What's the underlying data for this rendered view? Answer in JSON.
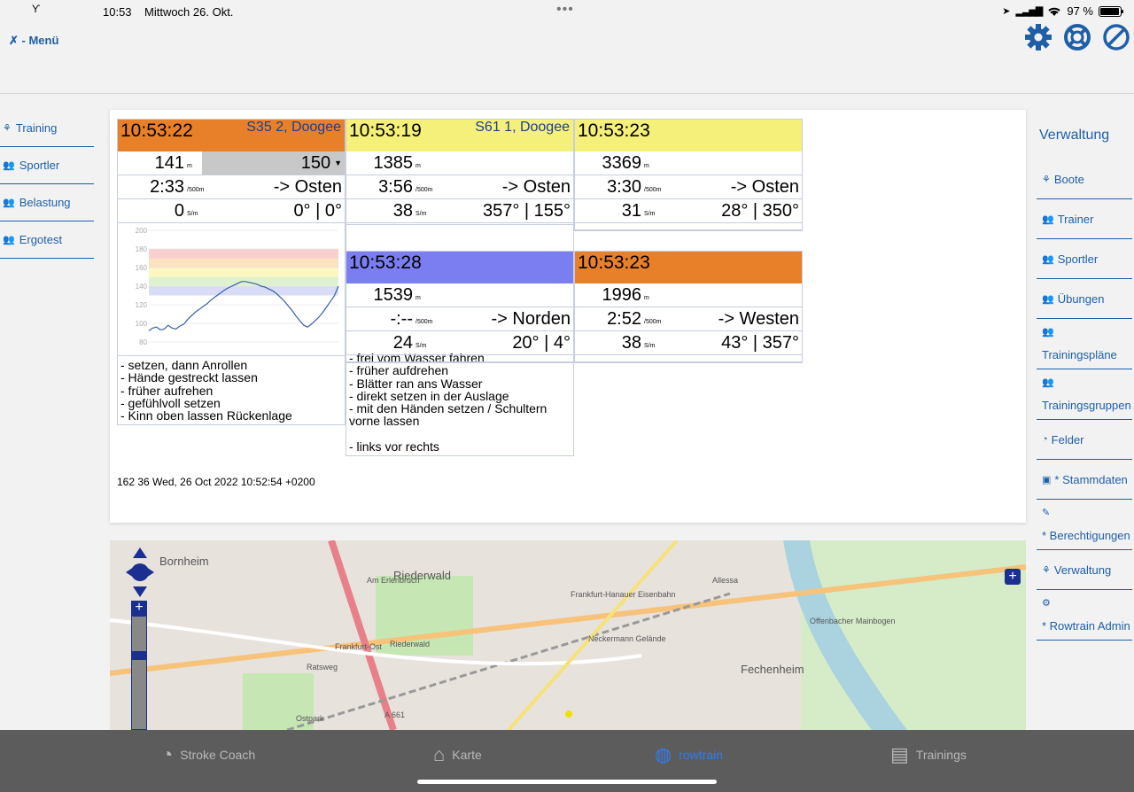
{
  "status": {
    "time": "10:53",
    "date": "Mittwoch 26. Okt.",
    "battery": "97 %",
    "battery_level": 0.97
  },
  "menu": {
    "label": "- Menü"
  },
  "left_nav": [
    {
      "label": "Training",
      "icon": "boats-icon"
    },
    {
      "label": "Sportler",
      "icon": "users-icon"
    },
    {
      "label": "Belastung",
      "icon": "users-icon"
    },
    {
      "label": "Ergotest",
      "icon": "users-icon"
    }
  ],
  "right_nav": {
    "title": "Verwaltung",
    "items": [
      {
        "label": "Boote",
        "icon": "boats-icon"
      },
      {
        "label": "Trainer",
        "icon": "users-icon"
      },
      {
        "label": "Sportler",
        "icon": "users-icon"
      },
      {
        "label": "Übungen",
        "icon": "users-icon"
      },
      {
        "label": "Trainingspläne",
        "icon": "users-icon"
      },
      {
        "label": "Trainingsgruppen",
        "icon": "users-icon"
      },
      {
        "label": "Felder",
        "icon": "dashboard-icon"
      },
      {
        "label": "* Stammdaten",
        "icon": "briefcase-icon"
      },
      {
        "label": "* Berechtigungen",
        "icon": "wrench-icon"
      },
      {
        "label": "Verwaltung",
        "icon": "boats-icon"
      },
      {
        "label": "* Rowtrain Admin",
        "icon": "gears-icon"
      }
    ]
  },
  "cards": [
    {
      "time": "10:53:22",
      "boat": "S35 2, Doogee",
      "color": "#e8802a",
      "distance": "141",
      "distance_unit": "m",
      "target": "150",
      "split": "2:33",
      "split_unit": "/500m",
      "direction": "-> Osten",
      "rate": "0",
      "rate_unit": "S/m",
      "angles": "0° | 0°",
      "notes": "- setzen, dann Anrollen\n- Hände gestreckt lassen\n- früher aufrehen\n- gefühlvoll setzen\n- Kinn oben lassen Rückenlage"
    },
    {
      "time": "10:53:19",
      "boat": "S61 1, Doogee",
      "color": "#f4f07a",
      "distance": "1385",
      "distance_unit": "m",
      "split": "3:56",
      "split_unit": "/500m",
      "direction": "-> Osten",
      "rate": "38",
      "rate_unit": "S/m",
      "angles": "357° | 155°",
      "notes": "- frei vom Wasser fahren\n- früher aufdrehen\n- Blätter ran ans Wasser\n- direkt setzen in der Auslage\n- mit den Händen setzen / Schultern vorne lassen\n\n- links vor rechts"
    },
    {
      "time": "10:53:23",
      "boat": "",
      "color": "#f4f07a",
      "distance": "3369",
      "distance_unit": "m",
      "split": "3:30",
      "split_unit": "/500m",
      "direction": "-> Osten",
      "rate": "31",
      "rate_unit": "S/m",
      "angles": "28° | 350°"
    },
    {
      "time": "10:53:28",
      "boat": "",
      "color": "#7a7ef0",
      "distance": "1539",
      "distance_unit": "m",
      "split": "-:--",
      "split_unit": "/500m",
      "direction": "-> Norden",
      "rate": "24",
      "rate_unit": "S/m",
      "angles": "20° | 4°"
    },
    {
      "time": "10:53:23",
      "boat": "",
      "color": "#e8802a",
      "distance": "1996",
      "distance_unit": "m",
      "split": "2:52",
      "split_unit": "/500m",
      "direction": "-> Westen",
      "rate": "38",
      "rate_unit": "S/m",
      "angles": "43° | 357°"
    }
  ],
  "chart_data": {
    "type": "line",
    "title": "",
    "xlabel": "",
    "ylabel": "",
    "ylim": [
      80,
      200
    ],
    "yticks": [
      80,
      100,
      120,
      140,
      160,
      180,
      200
    ],
    "zones": [
      {
        "from": 170,
        "to": 180,
        "color": "#f8d0d0"
      },
      {
        "from": 160,
        "to": 170,
        "color": "#fbe2c0"
      },
      {
        "from": 150,
        "to": 160,
        "color": "#fdf6c0"
      },
      {
        "from": 140,
        "to": 150,
        "color": "#dff2d0"
      },
      {
        "from": 130,
        "to": 140,
        "color": "#d8dcf6"
      }
    ],
    "values": [
      92,
      95,
      96,
      93,
      94,
      98,
      95,
      94,
      97,
      99,
      104,
      108,
      112,
      115,
      118,
      121,
      125,
      128,
      131,
      134,
      137,
      139,
      141,
      143,
      145,
      145,
      144,
      143,
      142,
      140,
      139,
      137,
      135,
      132,
      128,
      124,
      119,
      114,
      108,
      103,
      98,
      96,
      99,
      103,
      107,
      112,
      118,
      124,
      130,
      140
    ]
  },
  "timestamp": "162 36 Wed, 26 Oct 2022 10:52:54 +0200",
  "map": {
    "labels": [
      "Bornheim",
      "Riederwald",
      "Frankfurt-Ost",
      "Riederwald",
      "Ratsweg",
      "Ostpark",
      "A 661",
      "Fechenheim",
      "Neckermann Gelände",
      "Allessa",
      "Offenbacher Mainbogen",
      "Frankfurt-Hanauer Eisenbahn",
      "Am Erlenbruch"
    ]
  },
  "tabs": [
    {
      "label": "Stroke Coach",
      "active": false
    },
    {
      "label": "Karte",
      "active": false
    },
    {
      "label": "rowtrain",
      "active": true
    },
    {
      "label": "Trainings",
      "active": false
    }
  ]
}
